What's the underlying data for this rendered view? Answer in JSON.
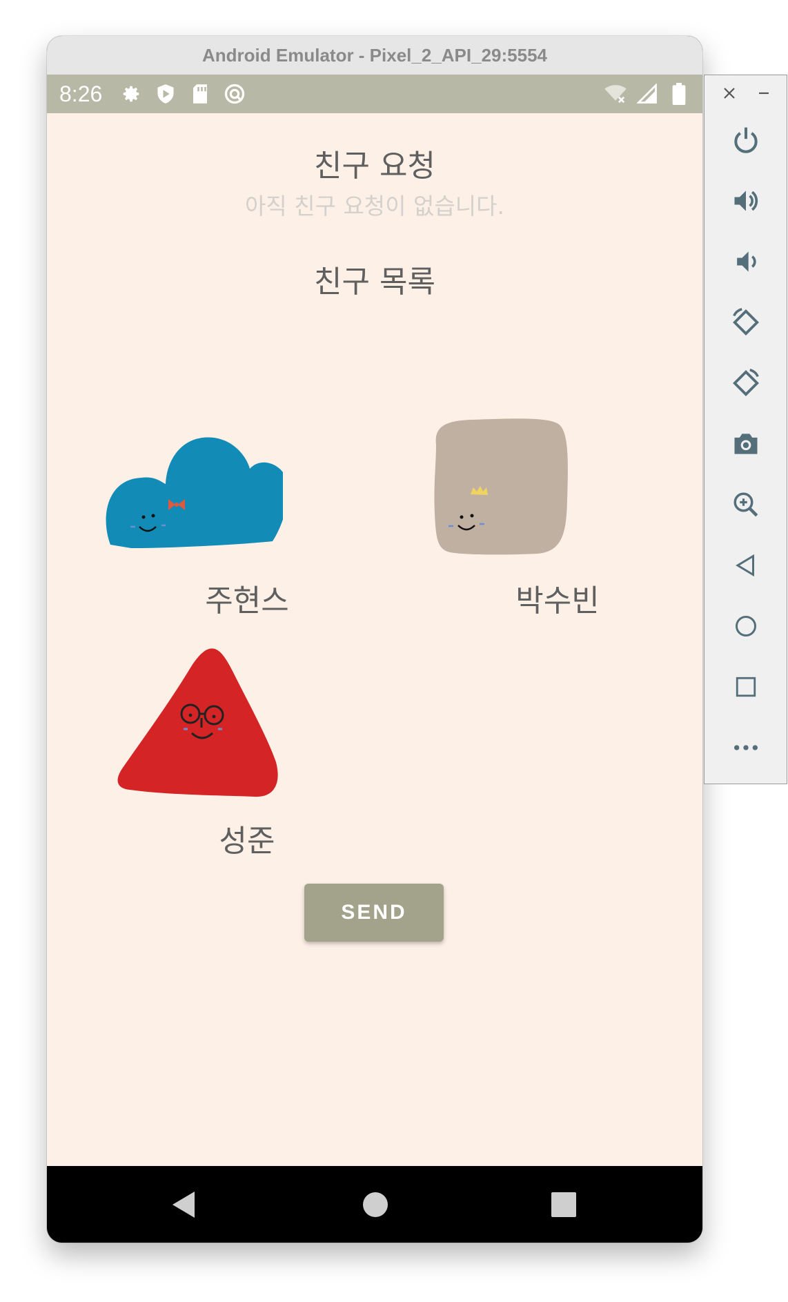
{
  "window": {
    "title": "Android Emulator - Pixel_2_API_29:5554"
  },
  "statusbar": {
    "time": "8:26",
    "left_icons": [
      "settings-icon",
      "shield-icon",
      "sd-card-icon",
      "sync-icon"
    ],
    "right_icons": [
      "wifi-off-icon",
      "signal-icon",
      "battery-icon"
    ]
  },
  "app": {
    "requests_heading": "친구 요청",
    "requests_empty": "아직 친구 요청이 없습니다.",
    "friends_heading": "친구 목록",
    "friends": [
      {
        "name": "주현스",
        "avatar": "blue-cloud-avatar",
        "color": "#128cb6"
      },
      {
        "name": "박수빈",
        "avatar": "beige-square-avatar",
        "color": "#c0b0a2"
      },
      {
        "name": "성준",
        "avatar": "red-triangle-avatar",
        "color": "#d52426"
      }
    ],
    "send_label": "SEND"
  },
  "navbar": {
    "buttons": [
      "back-icon",
      "home-icon",
      "recents-icon"
    ]
  },
  "side_toolbar": {
    "top": [
      "close-icon",
      "minimize-icon"
    ],
    "buttons": [
      "power-icon",
      "volume-up-icon",
      "volume-down-icon",
      "rotate-left-icon",
      "rotate-right-icon",
      "camera-icon",
      "zoom-icon",
      "back-icon",
      "home-icon",
      "overview-icon",
      "more-icon"
    ]
  },
  "colors": {
    "statusbar": "#b8b8a6",
    "screen_bg": "#fdf0e7",
    "button": "#a3a38c",
    "text": "#5f5f5f"
  }
}
